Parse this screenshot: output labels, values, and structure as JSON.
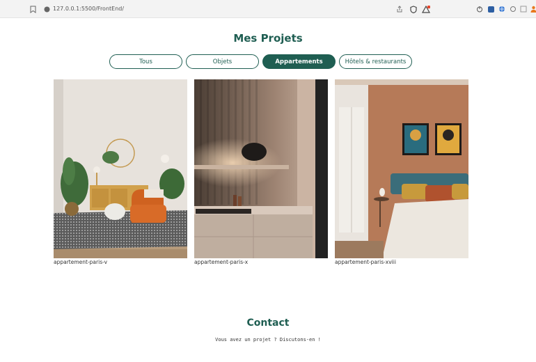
{
  "browser": {
    "url": "127.0.0.1:5500/FrontEnd/"
  },
  "projects": {
    "title": "Mes Projets",
    "filters": [
      "Tous",
      "Objets",
      "Appartements",
      "Hôtels & restaurants"
    ],
    "active_filter": "Appartements",
    "items": [
      {
        "caption": "appartement-paris-v"
      },
      {
        "caption": "appartement-paris-x"
      },
      {
        "caption": "appartement-paris-xviii"
      }
    ]
  },
  "contact": {
    "title": "Contact",
    "subtitle": "Vous avez un projet ? Discutons-en !"
  },
  "colors": {
    "brand": "#1f5e52"
  }
}
